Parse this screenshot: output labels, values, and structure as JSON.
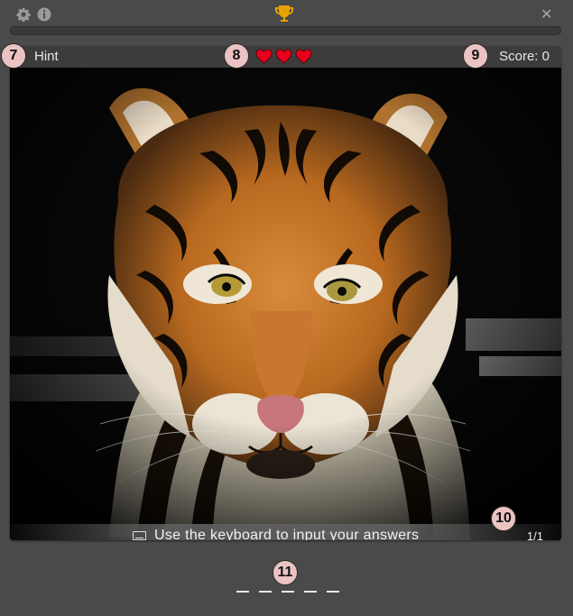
{
  "window": {
    "close_glyph": "✕"
  },
  "progress": {
    "value": 0
  },
  "header": {
    "hint_label": "Hint",
    "lives": 3,
    "score_label": "Score: 0"
  },
  "image": {
    "subject": "tiger"
  },
  "keyboard_banner": {
    "text": "Use the keyboard to input your answers"
  },
  "pager": {
    "text": "1/1"
  },
  "markers": {
    "hint": "7",
    "lives": "8",
    "score": "9",
    "pager": "10",
    "answer": "11"
  },
  "answer": {
    "slots": 5
  },
  "colors": {
    "trophy": "#e8a200",
    "heart": "#e8001c",
    "marker_bg": "#ecc3c3"
  },
  "icons": [
    "gear-icon",
    "info-icon",
    "trophy-icon",
    "close-icon",
    "heart-icon",
    "keyboard-icon"
  ]
}
